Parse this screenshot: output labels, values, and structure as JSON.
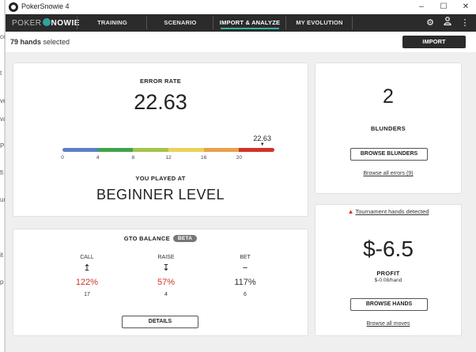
{
  "window": {
    "title": "PokerSnowie 4"
  },
  "background_app": {
    "edge_letters": [
      "ce",
      "t",
      "ve",
      "va",
      "P",
      "fi",
      "ur",
      "it",
      "p"
    ]
  },
  "nav": {
    "logo_left": "POKER",
    "logo_right": "NOWIE",
    "tabs": [
      "TRAINING",
      "SCENARIO",
      "IMPORT & ANALYZE",
      "MY EVOLUTION"
    ],
    "active_tab": "IMPORT & ANALYZE",
    "icons": [
      "gear-icon",
      "user-icon",
      "more-vertical-icon"
    ]
  },
  "selection": {
    "count": "79 hands",
    "suffix": "selected",
    "import_label": "IMPORT"
  },
  "error_rate": {
    "label": "ERROR RATE",
    "value": "22.63",
    "marker_value": 22.63,
    "marker_label": "22.63",
    "scale_ticks": [
      "0",
      "4",
      "8",
      "12",
      "16",
      "20"
    ],
    "scale_min": 0,
    "scale_max": 24,
    "scale_colors": [
      "#5b7fc6",
      "#3fa34d",
      "#a5c44a",
      "#e8d35a",
      "#e8a14a",
      "#d0332a"
    ],
    "played_at_label": "YOU PLAYED AT",
    "level": "BEGINNER LEVEL"
  },
  "blunders": {
    "value": "2",
    "label": "BLUNDERS",
    "button": "BROWSE BLUNDERS",
    "link": "Browse all errors (9)"
  },
  "gto": {
    "label": "GTO BALANCE",
    "badge": "BETA",
    "columns": [
      {
        "name": "CALL",
        "icon": "arrow-up-icon",
        "glyph": "↥",
        "pct": "122%",
        "count": "17",
        "color": "#d0332a"
      },
      {
        "name": "RAISE",
        "icon": "arrow-down-icon",
        "glyph": "↧",
        "pct": "57%",
        "count": "4",
        "color": "#d0332a"
      },
      {
        "name": "BET",
        "icon": "dash-icon",
        "glyph": "−",
        "pct": "117%",
        "count": "6",
        "color": "#333333"
      }
    ],
    "details_button": "DETAILS"
  },
  "profit": {
    "warning": "Tournament hands detected",
    "value": "$-6.5",
    "label": "PROFIT",
    "per_hand": "$-0.08/hand",
    "button": "BROWSE HANDS",
    "link": "Browse all moves"
  }
}
